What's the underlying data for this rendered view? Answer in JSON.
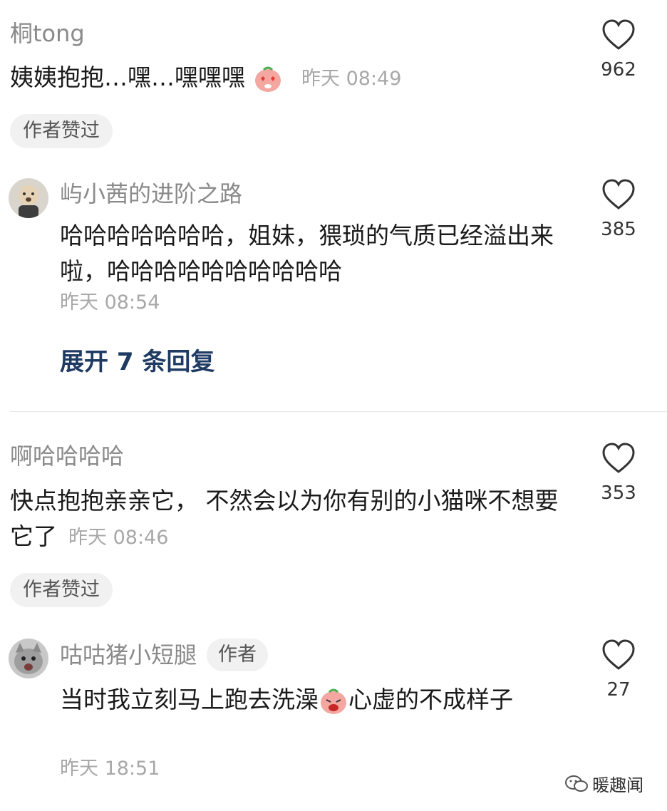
{
  "comments": [
    {
      "username": "桐tong",
      "text": "姨姨抱抱…嘿…嘿嘿嘿",
      "time": "昨天 08:49",
      "likes": "962",
      "badge": "作者赞过",
      "emoji": "heart-eyes-peach-emoji"
    },
    {
      "username": "屿小茜的进阶之路",
      "text": "哈哈哈哈哈哈哈，姐妹，猥琐的气质已经溢出来啦，哈哈哈哈哈哈哈哈哈哈",
      "time": "昨天 08:54",
      "likes": "385",
      "expand_label": "展开 7 条回复"
    },
    {
      "username": "啊哈哈哈哈",
      "text": "快点抱抱亲亲它， 不然会以为你有别的小猫咪不想要它了",
      "time": "昨天 08:46",
      "likes": "353",
      "badge": "作者赞过"
    },
    {
      "username": "咕咕猪小短腿",
      "author_tag": "作者",
      "text_before": "当时我立刻马上跑去洗澡",
      "text_after": "心虚的不成样子",
      "time": "昨天 18:51",
      "likes": "27",
      "emoji": "crying-peach-emoji"
    }
  ],
  "watermark": {
    "text": "暖趣闻",
    "icon": "wechat-icon"
  },
  "colors": {
    "link": "#1f3b63",
    "muted": "#8a8a8a",
    "chip_bg": "#f1f1f1"
  }
}
